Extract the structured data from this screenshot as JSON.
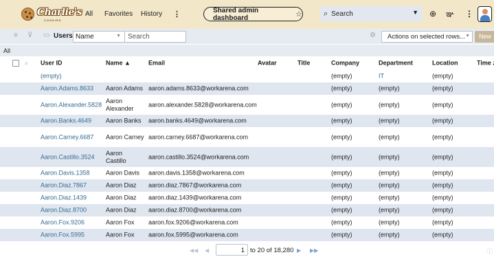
{
  "banner": {
    "logo_text": "Charlie's",
    "logo_subtext": "COOKIES",
    "nav": [
      "All",
      "Favorites",
      "History"
    ],
    "more_icon": "more-vertical-icon",
    "dashboard_pill": "Shared admin dashboard",
    "star_icon": "star-outline-icon",
    "search_label": "Search",
    "globe_icon": "globe-icon",
    "chat_icon": "chat-icon"
  },
  "toolbar": {
    "list_label": "Users",
    "field_select": "Name",
    "search_placeholder": "Search",
    "actions_select": "Actions on selected rows...",
    "new_button": "New"
  },
  "breadcrumb": "All",
  "table": {
    "headers": [
      "User ID",
      "Name ▲",
      "Email",
      "Avatar",
      "Title",
      "Company",
      "Department",
      "Location",
      "Time z"
    ],
    "rows": [
      {
        "user_id": "(empty)",
        "name": "",
        "email": "",
        "company": "(empty)",
        "department": "IT",
        "location": "(empty)"
      },
      {
        "user_id": "Aaron.Adams.8633",
        "name": "Aaron Adams",
        "email": "aaron.adams.8633@workarena.com",
        "company": "(empty)",
        "department": "(empty)",
        "location": "(empty)"
      },
      {
        "user_id": "Aaron.Alexander.5828",
        "name": "Aaron Alexander",
        "email": "aaron.alexander.5828@workarena.com",
        "company": "(empty)",
        "department": "(empty)",
        "location": "(empty)"
      },
      {
        "user_id": "Aaron.Banks.4649",
        "name": "Aaron Banks",
        "email": "aaron.banks.4649@workarena.com",
        "company": "(empty)",
        "department": "(empty)",
        "location": "(empty)"
      },
      {
        "user_id": "Aaron.Carney.6687",
        "name": "Aaron Carney",
        "email": "aaron.carney.6687@workarena.com",
        "company": "(empty)",
        "department": "(empty)",
        "location": "(empty)"
      },
      {
        "user_id": "Aaron.Castillo.3524",
        "name": "Aaron Castillo",
        "email": "aaron.castillo.3524@workarena.com",
        "company": "(empty)",
        "department": "(empty)",
        "location": "(empty)"
      },
      {
        "user_id": "Aaron.Davis.1358",
        "name": "Aaron Davis",
        "email": "aaron.davis.1358@workarena.com",
        "company": "(empty)",
        "department": "(empty)",
        "location": "(empty)"
      },
      {
        "user_id": "Aaron.Diaz.7867",
        "name": "Aaron Diaz",
        "email": "aaron.diaz.7867@workarena.com",
        "company": "(empty)",
        "department": "(empty)",
        "location": "(empty)"
      },
      {
        "user_id": "Aaron.Diaz.1439",
        "name": "Aaron Diaz",
        "email": "aaron.diaz.1439@workarena.com",
        "company": "(empty)",
        "department": "(empty)",
        "location": "(empty)"
      },
      {
        "user_id": "Aaron.Diaz.8700",
        "name": "Aaron Diaz",
        "email": "aaron.diaz.8700@workarena.com",
        "company": "(empty)",
        "department": "(empty)",
        "location": "(empty)"
      },
      {
        "user_id": "Aaron.Fox.9206",
        "name": "Aaron Fox",
        "email": "aaron.fox.9206@workarena.com",
        "company": "(empty)",
        "department": "(empty)",
        "location": "(empty)"
      },
      {
        "user_id": "Aaron.Fox.5995",
        "name": "Aaron Fox",
        "email": "aaron.fox.5995@workarena.com",
        "company": "(empty)",
        "department": "(empty)",
        "location": "(empty)"
      }
    ]
  },
  "pager": {
    "page_value": "1",
    "range_text": "to 20 of 18,280"
  },
  "colors": {
    "banner_bg": "#f2e7c9",
    "toolbar_bg": "#e6ebf2",
    "row_alt_bg": "#dfe6f0",
    "link": "#376b8f"
  }
}
